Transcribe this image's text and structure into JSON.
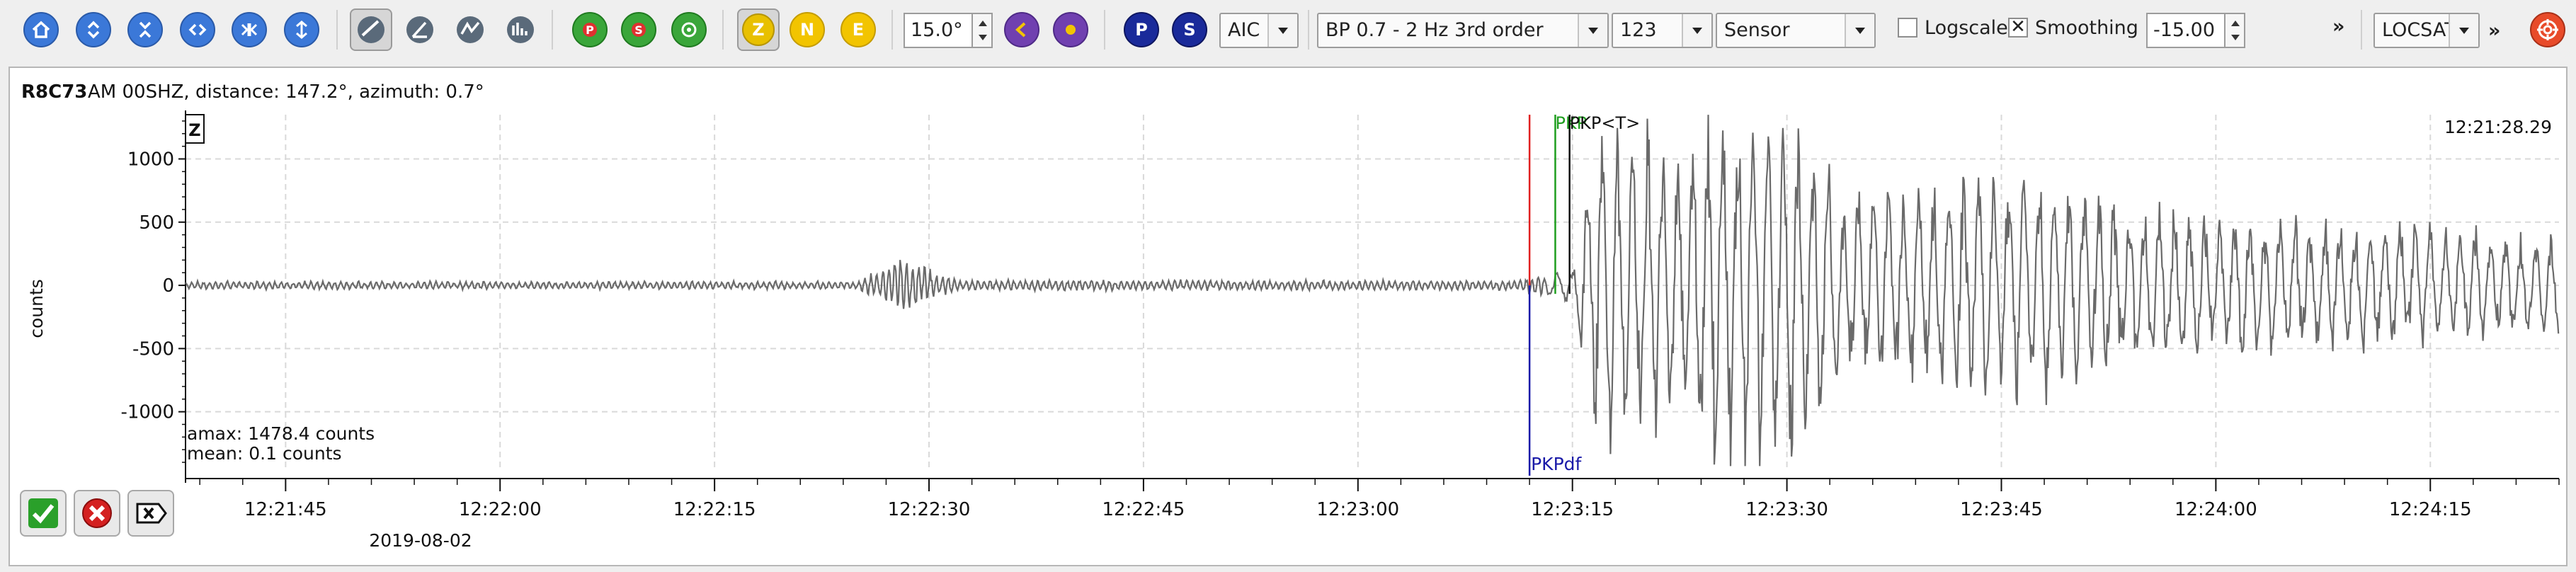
{
  "toolbar": {
    "nav_icons": [
      "home-icon",
      "zoom-in-vertical-icon",
      "zoom-out-vertical-icon",
      "zoom-in-horizontal-icon",
      "zoom-out-horizontal-icon",
      "reset-scale-icon"
    ],
    "tool_icons": [
      "trigger-icon",
      "rotate-icon",
      "filter-icon",
      "spectrum-icon"
    ],
    "comp_icons": [
      "phase-p-icon",
      "phase-s-icon",
      "relocate-icon"
    ],
    "components": [
      "Z",
      "N",
      "E"
    ],
    "angle": "15.0°",
    "picker_icons": [
      "left-pick-icon",
      "right-pick-icon"
    ],
    "phases": [
      "P",
      "S"
    ],
    "method": "AIC",
    "filter": "BP 0.7 - 2 Hz  3rd order",
    "channel": "123",
    "sensor": "Sensor",
    "logscale_label": "Logscale",
    "logscale_checked": false,
    "smoothing_label": "Smoothing",
    "smoothing_checked": true,
    "smoothing_value": "-15.00",
    "more1": "»",
    "locator": "LOCSAT",
    "more2": "»",
    "locate_icon": "target-icon",
    "colors": {
      "z": "#e8c000",
      "n": "#f2c400",
      "e": "#f2c400",
      "p": "#1a2a9a",
      "s": "#1a2a9a",
      "green": "#2ca02c",
      "purple": "#7040b0"
    }
  },
  "trace": {
    "station": "R8C73",
    "network_channel": "AM  00SHZ, distance: 147.2°, azimuth: 0.7°",
    "component": "Z",
    "time_label": "12:21:28.29",
    "ylabel": "counts",
    "amax": "amax: 1478.4 counts",
    "mean": "mean: 0.1 counts",
    "date": "2019-08-02",
    "picks": [
      {
        "label": "PKPdf",
        "color": "#1a1aa8",
        "t": 12
      },
      {
        "label": "PKP",
        "color": "#1e9e1e",
        "t": 13.8
      },
      {
        "label": "PKP<T>",
        "color": "#111111",
        "t": 14.8
      }
    ],
    "red_marker": 12
  },
  "chart_data": {
    "type": "line",
    "title": "",
    "xlabel": "",
    "ylabel": "counts",
    "xlim": [
      "12:21:38",
      "12:24:24"
    ],
    "ylim": [
      -1450,
      1350
    ],
    "y_ticks": [
      1000,
      500,
      0,
      -500,
      -1000
    ],
    "x_tick_labels": [
      "12:21:45",
      "12:22:00",
      "12:22:15",
      "12:22:30",
      "12:22:45",
      "12:23:00",
      "12:23:15",
      "12:23:30",
      "12:23:45",
      "12:24:00",
      "12:24:15"
    ],
    "x_tick_seconds": [
      -75,
      -60,
      -45,
      -30,
      -15,
      0,
      15,
      30,
      45,
      60,
      75
    ],
    "grid": true,
    "series": [
      {
        "amplitude_envelope": [
          {
            "t": -90,
            "a": 30
          },
          {
            "t": -35,
            "a": 30
          },
          {
            "t": -32,
            "a": 210
          },
          {
            "t": -28,
            "a": 40
          },
          {
            "t": 11,
            "a": 35
          },
          {
            "t": 15,
            "a": 150
          },
          {
            "t": 17,
            "a": 1300
          },
          {
            "t": 22,
            "a": 1000
          },
          {
            "t": 26,
            "a": 1450
          },
          {
            "t": 30,
            "a": 1400
          },
          {
            "t": 34,
            "a": 700
          },
          {
            "t": 45,
            "a": 950
          },
          {
            "t": 55,
            "a": 600
          },
          {
            "t": 75,
            "a": 450
          },
          {
            "t": 90,
            "a": 300
          }
        ]
      }
    ]
  },
  "footer": {
    "buttons": [
      "accept-icon",
      "reject-icon",
      "close-icon"
    ]
  }
}
